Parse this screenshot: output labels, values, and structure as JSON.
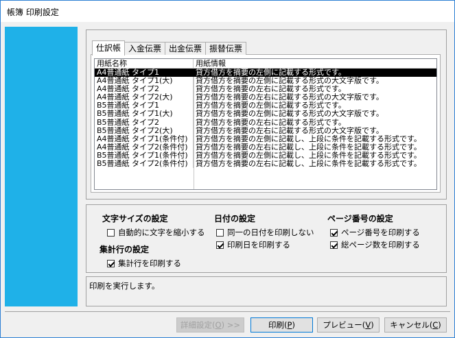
{
  "window": {
    "title": "帳簿 印刷設定"
  },
  "tabs": [
    {
      "label": "仕訳帳",
      "active": true
    },
    {
      "label": "入金伝票",
      "active": false
    },
    {
      "label": "出金伝票",
      "active": false
    },
    {
      "label": "振替伝票",
      "active": false
    }
  ],
  "list": {
    "columns": [
      "用紙名称",
      "用紙情報"
    ],
    "rows": [
      {
        "name": "A4普通紙 タイプ1",
        "info": "貸方借方を摘要の左側に記載する形式です。",
        "selected": true
      },
      {
        "name": "A4普通紙 タイプ1(大)",
        "info": "貸方借方を摘要の左側に記載する形式の大文字版です。",
        "selected": false
      },
      {
        "name": "A4普通紙 タイプ2",
        "info": "貸方借方を摘要の左右に記載する形式です。",
        "selected": false
      },
      {
        "name": "A4普通紙 タイプ2(大)",
        "info": "貸方借方を摘要の左右に記載する形式の大文字版です。",
        "selected": false
      },
      {
        "name": "B5普通紙 タイプ1",
        "info": "貸方借方を摘要の左側に記載する形式です。",
        "selected": false
      },
      {
        "name": "B5普通紙 タイプ1(大)",
        "info": "貸方借方を摘要の左側に記載する形式の大文字版です。",
        "selected": false
      },
      {
        "name": "B5普通紙 タイプ2",
        "info": "貸方借方を摘要の左右に記載する形式です。",
        "selected": false
      },
      {
        "name": "B5普通紙 タイプ2(大)",
        "info": "貸方借方を摘要の左右に記載する形式の大文字版です。",
        "selected": false
      },
      {
        "name": "A4普通紙 タイプ1(条件付)",
        "info": "貸方借方を摘要の左側に記載し、上段に条件を記載する形式です。",
        "selected": false
      },
      {
        "name": "A4普通紙 タイプ2(条件付)",
        "info": "貸方借方を摘要の左右に記載し、上段に条件を記載する形式です。",
        "selected": false
      },
      {
        "name": "B5普通紙 タイプ1(条件付)",
        "info": "貸方借方を摘要の左側に記載し、上段に条件を記載する形式です。",
        "selected": false
      },
      {
        "name": "B5普通紙 タイプ2(条件付)",
        "info": "貸方借方を摘要の左右に記載し、上段に条件を記載する形式です。",
        "selected": false
      }
    ]
  },
  "settings": {
    "font_size": {
      "title": "文字サイズの設定",
      "options": [
        {
          "label": "自動的に文字を縮小する",
          "checked": false
        }
      ]
    },
    "total_row": {
      "title": "集計行の設定",
      "options": [
        {
          "label": "集計行を印刷する",
          "checked": true
        }
      ]
    },
    "date": {
      "title": "日付の設定",
      "options": [
        {
          "label": "同一の日付を印刷しない",
          "checked": false
        },
        {
          "label": "印刷日を印刷する",
          "checked": true
        }
      ]
    },
    "page_number": {
      "title": "ページ番号の設定",
      "options": [
        {
          "label": "ページ番号を印刷する",
          "checked": true
        },
        {
          "label": "総ページ数を印刷する",
          "checked": true
        }
      ]
    }
  },
  "status": {
    "message": "印刷を実行します。"
  },
  "buttons": {
    "details": {
      "label": "詳細設定(",
      "key": "O",
      "suffix": ") >>",
      "enabled": false
    },
    "print": {
      "label": "印刷(",
      "key": "P",
      "suffix": ")"
    },
    "preview": {
      "label": "プレビュー(",
      "key": "V",
      "suffix": ")"
    },
    "cancel": {
      "label": "キャンセル(",
      "key": "C",
      "suffix": ")"
    }
  }
}
